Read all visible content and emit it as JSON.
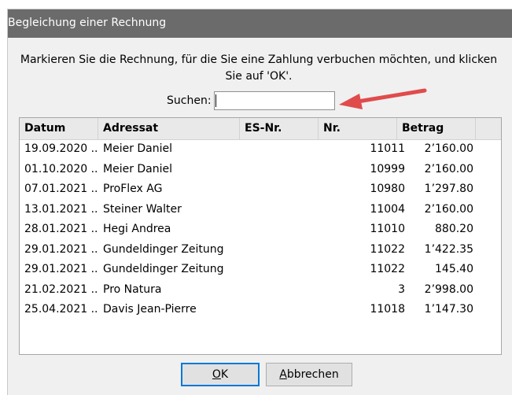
{
  "window": {
    "title": "Begleichung einer Rechnung"
  },
  "instruction": "Markieren Sie die Rechnung, für die Sie eine Zahlung verbuchen möchten, und klicken Sie auf 'OK'.",
  "search": {
    "label": "Suchen:",
    "value": ""
  },
  "table": {
    "columns": [
      "Datum",
      "Adressat",
      "ES-Nr.",
      "Nr.",
      "Betrag"
    ],
    "rows": [
      {
        "datum": "19.09.2020 ...",
        "adressat": "Meier Daniel",
        "es_nr": "",
        "nr": "11011",
        "betrag": "2’160.00"
      },
      {
        "datum": "01.10.2020 ...",
        "adressat": "Meier Daniel",
        "es_nr": "",
        "nr": "10999",
        "betrag": "2’160.00"
      },
      {
        "datum": "07.01.2021 ...",
        "adressat": "ProFlex AG",
        "es_nr": "",
        "nr": "10980",
        "betrag": "1’297.80"
      },
      {
        "datum": "13.01.2021 ...",
        "adressat": "Steiner Walter",
        "es_nr": "",
        "nr": "11004",
        "betrag": "2’160.00"
      },
      {
        "datum": "28.01.2021 ...",
        "adressat": "Hegi Andrea",
        "es_nr": "",
        "nr": "11010",
        "betrag": "880.20"
      },
      {
        "datum": "29.01.2021 ...",
        "adressat": "Gundeldinger Zeitung",
        "es_nr": "",
        "nr": "11022",
        "betrag": "1’422.35"
      },
      {
        "datum": "29.01.2021 ...",
        "adressat": "Gundeldinger Zeitung",
        "es_nr": "",
        "nr": "11022",
        "betrag": "145.40"
      },
      {
        "datum": "21.02.2021 ...",
        "adressat": "Pro Natura",
        "es_nr": "",
        "nr": "3",
        "betrag": "2’998.00"
      },
      {
        "datum": "25.04.2021 ...",
        "adressat": "Davis Jean-Pierre",
        "es_nr": "",
        "nr": "11018",
        "betrag": "1’147.30"
      }
    ]
  },
  "buttons": {
    "ok": {
      "mnemonic": "O",
      "rest": "K"
    },
    "cancel": {
      "mnemonic": "A",
      "rest": "bbrechen"
    }
  },
  "colors": {
    "titlebar": "#6b6b6b",
    "annotation_arrow": "#e04b4b",
    "default_button_border": "#0078d7"
  },
  "icons": [
    "annotation-arrow-icon"
  ]
}
